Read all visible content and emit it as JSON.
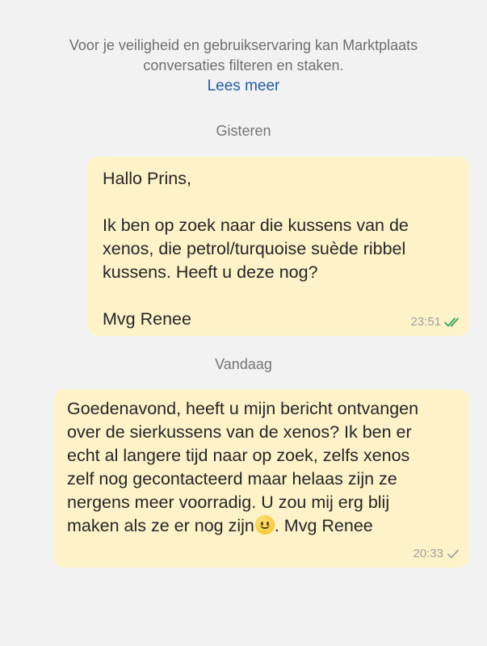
{
  "notice": {
    "line1": "Voor je veiligheid en gebruikservaring kan Marktplaats",
    "line2": "conversaties filteren en staken.",
    "read_more": "Lees meer"
  },
  "days": {
    "first": "Gisteren",
    "second": "Vandaag"
  },
  "messages": [
    {
      "text": "Hallo Prins,\n\nIk ben op zoek naar die kussens van de\nxenos, die petrol/turquoise suède ribbel\nkussens. Heeft u deze nog?\n\nMvg Renee",
      "time": "23:51",
      "status": "read",
      "tick_color": "#3aa35c"
    },
    {
      "text_before_emoji": "Goedenavond, heeft u mijn bericht ontvangen\nover de sierkussens van de xenos? Ik ben er\necht al langere tijd naar op zoek, zelfs xenos\nzelf nog gecontacteerd maar helaas zijn ze\nnergens meer voorradig. U zou mij erg blij\nmaken als ze er nog zijn",
      "emoji": "slightly-smiling-face",
      "text_after_emoji": ". Mvg Renee",
      "time": "20:33",
      "status": "sent",
      "tick_color": "#a2a2a2"
    }
  ],
  "colors": {
    "background": "#f2f2f2",
    "bubble": "#fdf2c8",
    "link": "#1f5fa8"
  }
}
